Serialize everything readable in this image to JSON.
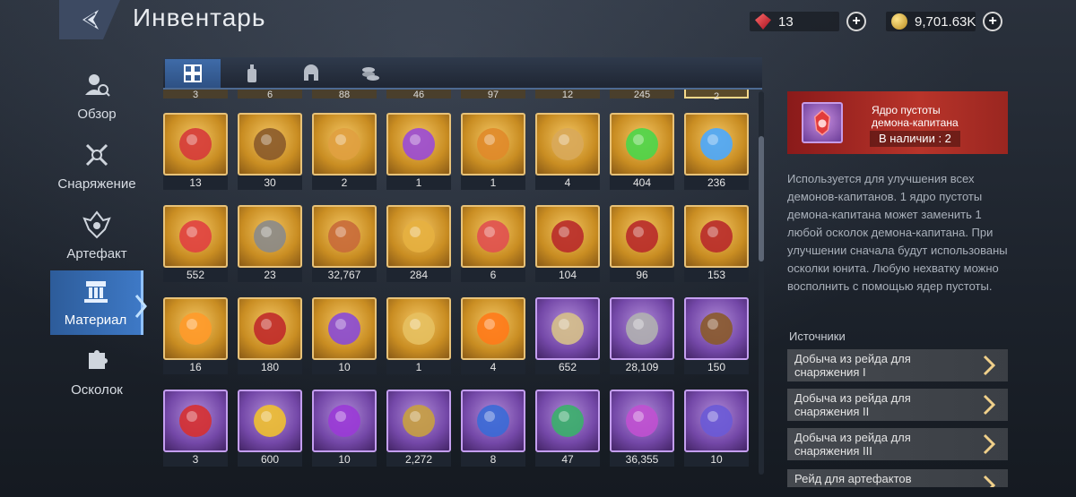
{
  "header": {
    "title": "Инвентарь"
  },
  "currency": {
    "gems": {
      "icon": "red-gem-icon",
      "value": "13"
    },
    "gold": {
      "icon": "gold-coin-icon",
      "value": "9,701.63K"
    }
  },
  "sidebar": {
    "items": [
      {
        "label": "Обзор",
        "icon": "overview-icon"
      },
      {
        "label": "Снаряжение",
        "icon": "crossed-swords-icon"
      },
      {
        "label": "Артефакт",
        "icon": "artifact-icon"
      },
      {
        "label": "Материал",
        "icon": "material-icon",
        "active": true
      },
      {
        "label": "Осколок",
        "icon": "puzzle-piece-icon"
      }
    ]
  },
  "tabs": [
    {
      "icon": "grid-icon",
      "active": true
    },
    {
      "icon": "potion-icon"
    },
    {
      "icon": "helmet-icon"
    },
    {
      "icon": "coins-icon"
    }
  ],
  "partial_row": [
    "3",
    "6",
    "88",
    "46",
    "97",
    "12",
    "245",
    "2"
  ],
  "grid": [
    [
      {
        "c": "13",
        "r": "gold",
        "i": "red-crystals"
      },
      {
        "c": "30",
        "r": "gold",
        "i": "bronze-medal"
      },
      {
        "c": "2",
        "r": "gold",
        "i": "star-book"
      },
      {
        "c": "1",
        "r": "gold",
        "i": "purple-star-book"
      },
      {
        "c": "1",
        "r": "gold",
        "i": "golden-book"
      },
      {
        "c": "4",
        "r": "gold",
        "i": "crystal-cluster"
      },
      {
        "c": "404",
        "r": "gold",
        "i": "green-flame"
      },
      {
        "c": "236",
        "r": "gold",
        "i": "blue-flame"
      }
    ],
    [
      {
        "c": "552",
        "r": "gold",
        "i": "red-spirit"
      },
      {
        "c": "23",
        "r": "gold",
        "i": "hammer"
      },
      {
        "c": "32,767",
        "r": "gold",
        "i": "ore-pile"
      },
      {
        "c": "284",
        "r": "gold",
        "i": "golden-knight"
      },
      {
        "c": "6",
        "r": "gold",
        "i": "red-crystal"
      },
      {
        "c": "104",
        "r": "gold",
        "i": "red-shield"
      },
      {
        "c": "96",
        "r": "gold",
        "i": "red-shield"
      },
      {
        "c": "153",
        "r": "gold",
        "i": "red-shield"
      }
    ],
    [
      {
        "c": "16",
        "r": "gold",
        "i": "orange-orb"
      },
      {
        "c": "180",
        "r": "gold",
        "i": "red-emblem"
      },
      {
        "c": "10",
        "r": "gold",
        "i": "purple-swirl"
      },
      {
        "c": "1",
        "r": "gold",
        "i": "golden-card"
      },
      {
        "c": "4",
        "r": "gold",
        "i": "orange-gem"
      },
      {
        "c": "652",
        "r": "purple",
        "i": "crossed-swords"
      },
      {
        "c": "28,109",
        "r": "purple",
        "i": "ore-chunk"
      },
      {
        "c": "150",
        "r": "purple",
        "i": "bronze-medal"
      }
    ],
    [
      {
        "c": "3",
        "r": "purple",
        "i": "red-shard"
      },
      {
        "c": "600",
        "r": "purple",
        "i": "yellow-potion"
      },
      {
        "c": "10",
        "r": "purple",
        "i": "purple-crystal"
      },
      {
        "c": "2,272",
        "r": "purple",
        "i": "gold-emblem"
      },
      {
        "c": "8",
        "r": "purple",
        "i": "blue-emblem"
      },
      {
        "c": "47",
        "r": "purple",
        "i": "green-emblem"
      },
      {
        "c": "36,355",
        "r": "purple",
        "i": "purple-dust"
      },
      {
        "c": "10",
        "r": "purple",
        "i": "armored-knight"
      }
    ]
  ],
  "detail": {
    "name": "Ядро пустоты демона-капитана",
    "stock": "В наличии : 2",
    "description": "Используется для улучшения всех демонов-капитанов. 1 ядро пустоты демона-капитана может заменить 1 любой осколок демона-капитана. При улучшении сначала будут использованы осколки юнита. Любую нехватку можно восполнить с помощью ядер пустоты.",
    "sources_title": "Источники",
    "sources": [
      "Добыча из рейда для снаряжения I",
      "Добыча из рейда для снаряжения II",
      "Добыча из рейда для снаряжения III",
      "Рейд для артефактов"
    ]
  },
  "colors": {
    "gold_frame": "#c98d22",
    "purple_frame": "#7448a8",
    "active_tab": "#3e79c6",
    "detail_header": "#b8342a"
  }
}
